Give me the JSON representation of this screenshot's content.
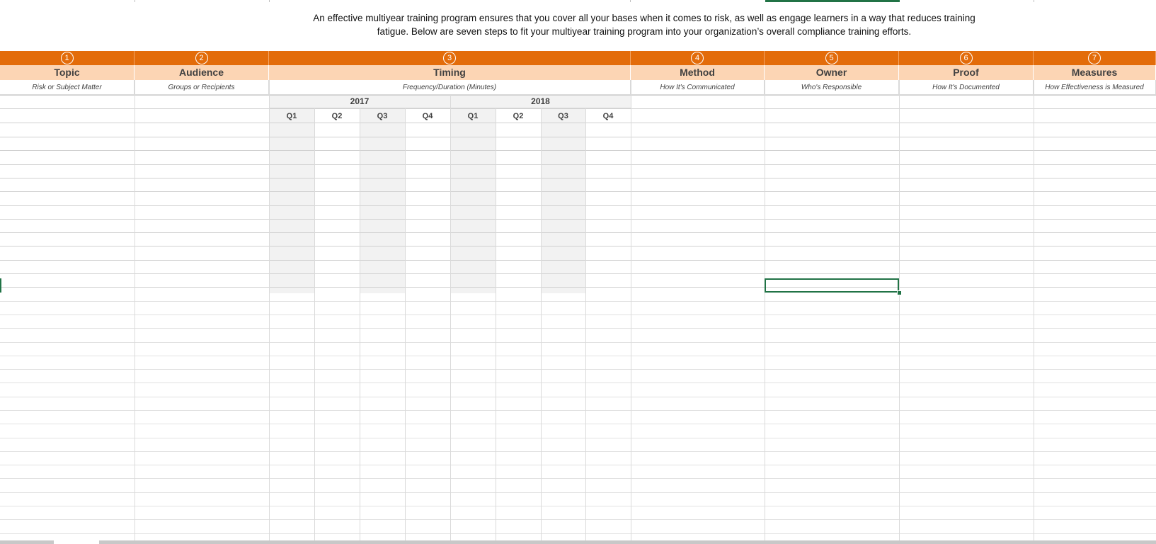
{
  "intro": {
    "line1": "An effective multiyear training program ensures that you cover all your bases when it comes to risk, as well as engage learners in a way that reduces training",
    "line2": "fatigue. Below are seven steps to fit your multiyear training program into your organization’s overall compliance training efforts."
  },
  "steps": [
    {
      "number": "1",
      "title": "Topic",
      "subtitle": "Risk or Subject Matter"
    },
    {
      "number": "2",
      "title": "Audience",
      "subtitle": "Groups or Recipients"
    },
    {
      "number": "3",
      "title": "Timing",
      "subtitle": "Frequency/Duration (Minutes)"
    },
    {
      "number": "4",
      "title": "Method",
      "subtitle": "How It's Communicated"
    },
    {
      "number": "5",
      "title": "Owner",
      "subtitle": "Who's Responsible"
    },
    {
      "number": "6",
      "title": "Proof",
      "subtitle": "How It's Documented"
    },
    {
      "number": "7",
      "title": "Measures",
      "subtitle": "How Effectiveness is Measured"
    }
  ],
  "timing": {
    "years": [
      "2017",
      "2018"
    ],
    "quarters": [
      "Q1",
      "Q2",
      "Q3",
      "Q4",
      "Q1",
      "Q2",
      "Q3",
      "Q4"
    ]
  },
  "colors": {
    "orange_band": "#e36c0a",
    "peach_band": "#fcd5b4",
    "quarter_shade": "#f2f2f2",
    "selection": "#217346"
  }
}
